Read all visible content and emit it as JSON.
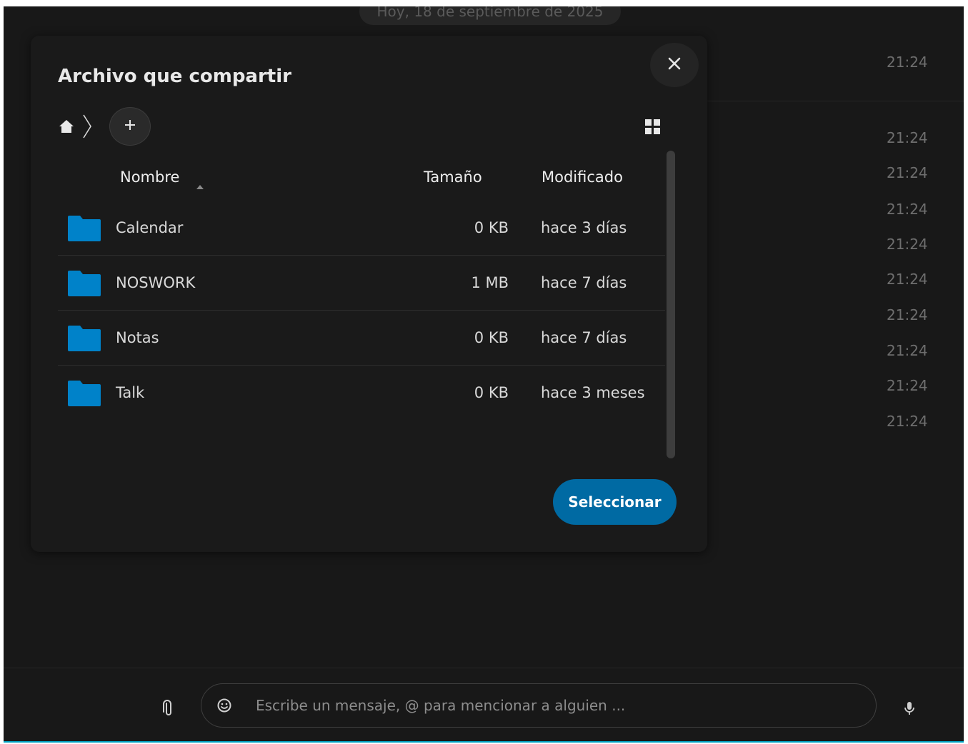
{
  "chat": {
    "date_divider": "Hoy, 18 de septiembre de 2025",
    "timestamps": [
      "21:24",
      "21:24",
      "21:24",
      "21:24",
      "21:24",
      "21:24",
      "21:24",
      "21:24",
      "21:24",
      "21:24"
    ]
  },
  "composer": {
    "placeholder": "Escribe un mensaje, @ para mencionar a alguien ...",
    "icons": [
      "paperclip-icon",
      "emoji-icon",
      "microphone-icon"
    ]
  },
  "dialog": {
    "title": "Archivo que compartir",
    "close_icon": "close-icon",
    "breadcrumb_icons": [
      "home-icon",
      "chevron-right-icon",
      "plus-icon"
    ],
    "view_toggle_icon": "grid-view-icon",
    "columns": {
      "name": "Nombre",
      "size": "Tamaño",
      "modified": "Modificado",
      "sort": "ascending"
    },
    "files": [
      {
        "name": "Calendar",
        "size": "0 KB",
        "modified": "hace 3 días"
      },
      {
        "name": "NOSWORK",
        "size": "1 MB",
        "modified": "hace 7 días"
      },
      {
        "name": "Notas",
        "size": "0 KB",
        "modified": "hace 7 días"
      },
      {
        "name": "Talk",
        "size": "0 KB",
        "modified": "hace 3 meses"
      }
    ],
    "select_label": "Seleccionar"
  },
  "colors": {
    "accent": "#006aa3",
    "folder": "#0082c9",
    "dialog_bg": "#1a1a1a",
    "chat_bg": "#181818"
  }
}
